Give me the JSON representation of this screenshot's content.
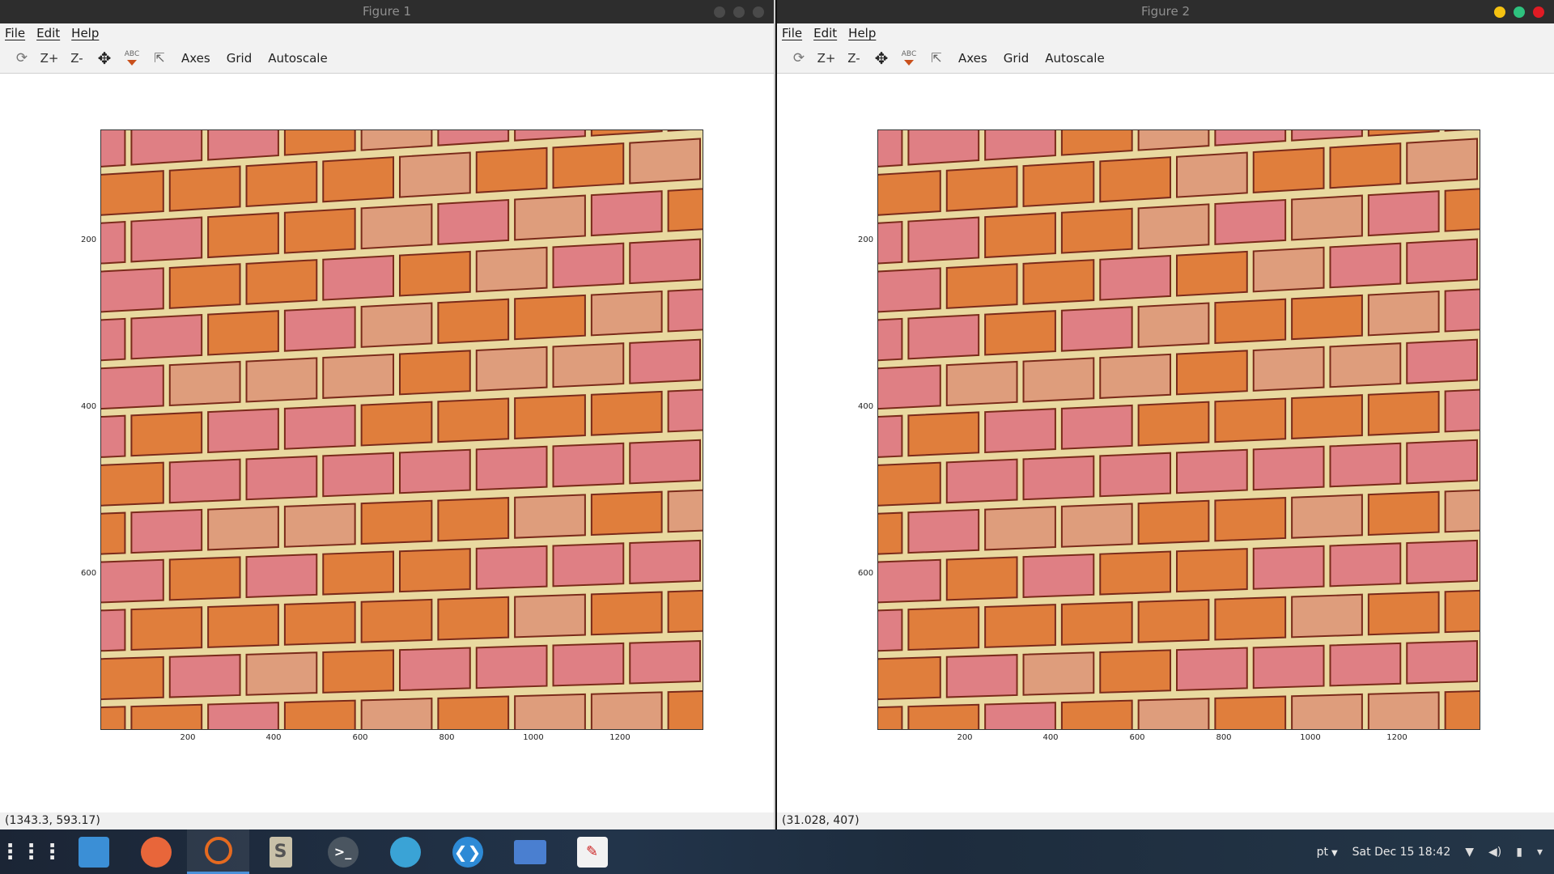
{
  "windows": [
    {
      "title": "Figure 1",
      "menu": [
        "File",
        "Edit",
        "Help"
      ],
      "toolbar": {
        "zoom_in": "Z+",
        "zoom_out": "Z-",
        "text_icon": "ABC",
        "axes": "Axes",
        "grid": "Grid",
        "autoscale": "Autoscale"
      },
      "plot": {
        "y_ticks": [
          "200",
          "400",
          "600"
        ],
        "x_ticks": [
          "200",
          "400",
          "600",
          "800",
          "1000",
          "1200"
        ]
      },
      "status": "(1343.3, 593.17)"
    },
    {
      "title": "Figure 2",
      "menu": [
        "File",
        "Edit",
        "Help"
      ],
      "toolbar": {
        "zoom_in": "Z+",
        "zoom_out": "Z-",
        "text_icon": "ABC",
        "axes": "Axes",
        "grid": "Grid",
        "autoscale": "Autoscale"
      },
      "plot": {
        "y_ticks": [
          "200",
          "400",
          "600"
        ],
        "x_ticks": [
          "200",
          "400",
          "600",
          "800",
          "1000",
          "1200"
        ]
      },
      "status": "(31.028, 407)"
    }
  ],
  "taskbar": {
    "apps": [
      "app-grid-icon",
      "files-icon",
      "firefox-icon",
      "octave-icon",
      "sublime-icon",
      "terminal-icon",
      "finder-icon",
      "vscode-icon",
      "screenshot-icon",
      "pdf-viewer-icon"
    ],
    "s_letter": "S",
    "term_glyph": ">_",
    "keyboard_layout": "pt",
    "datetime": "Sat Dec 15  18:42"
  },
  "colors": {
    "mortar": "#e9d9a0",
    "brick_orange": "#e07e3c",
    "brick_pink": "#df7f84",
    "brick_salmon": "#de9d7c",
    "shadow": "#7a2a1a"
  }
}
